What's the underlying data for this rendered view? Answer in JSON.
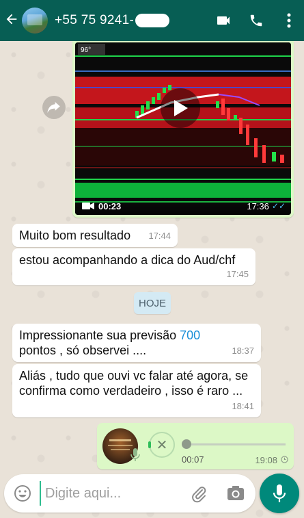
{
  "header": {
    "contact_name": "+55 75 9241-",
    "icons": [
      "back-arrow-icon",
      "video-call-icon",
      "phone-icon",
      "more-vert-icon"
    ]
  },
  "messages": [
    {
      "type": "video",
      "direction": "out",
      "duration": "00:23",
      "time": "17:36",
      "status": "read"
    },
    {
      "type": "text",
      "direction": "in",
      "text": "Muito bom resultado",
      "time": "17:44"
    },
    {
      "type": "text",
      "direction": "in",
      "text": "estou acompanhando a dica do Aud/chf",
      "time": "17:45"
    },
    {
      "type": "day_divider",
      "text": "HOJE"
    },
    {
      "type": "text",
      "direction": "in",
      "text_before": "Impressionante sua previsão ",
      "highlight": "700",
      "text_after": "pontos  , só observei ....",
      "time": "18:37"
    },
    {
      "type": "text",
      "direction": "in",
      "text": "Aliás , tudo que ouvi vc falar até agora, se confirma como verdadeiro ,  isso é raro ...",
      "time": "18:41"
    },
    {
      "type": "voice",
      "direction": "out",
      "duration": "00:07",
      "time": "19:08",
      "status": "pending",
      "progress": 0
    }
  ],
  "input": {
    "placeholder": "Digite aqui...",
    "value": ""
  },
  "colors": {
    "header": "#075e54",
    "outgoing_bubble": "#dcf8c6",
    "incoming_bubble": "#ffffff",
    "fab": "#00897b",
    "link_number": "#1a8fd8"
  }
}
